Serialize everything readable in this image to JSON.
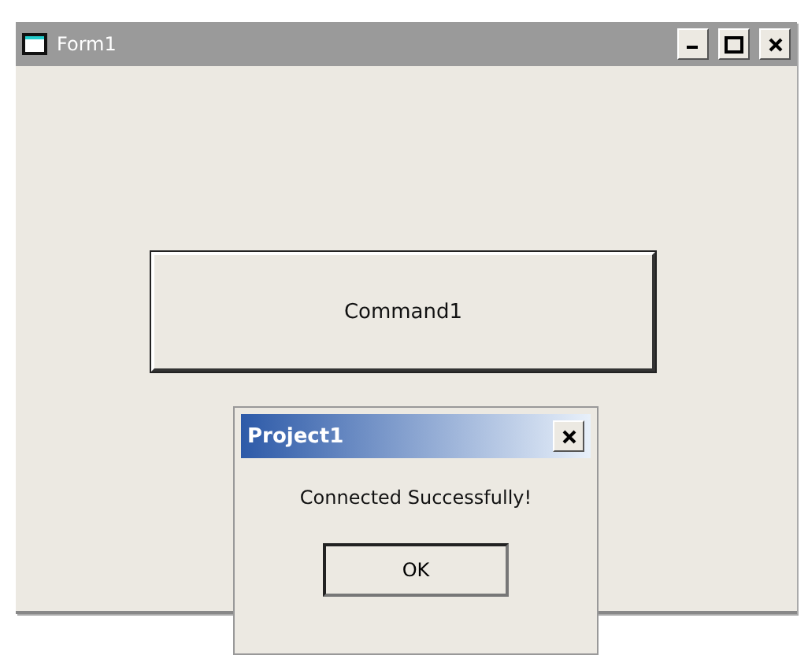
{
  "window": {
    "title": "Form1",
    "active": false
  },
  "command_button": {
    "label": "Command1"
  },
  "message_box": {
    "title": "Project1",
    "message": "Connected Successfully!",
    "button": "OK"
  }
}
